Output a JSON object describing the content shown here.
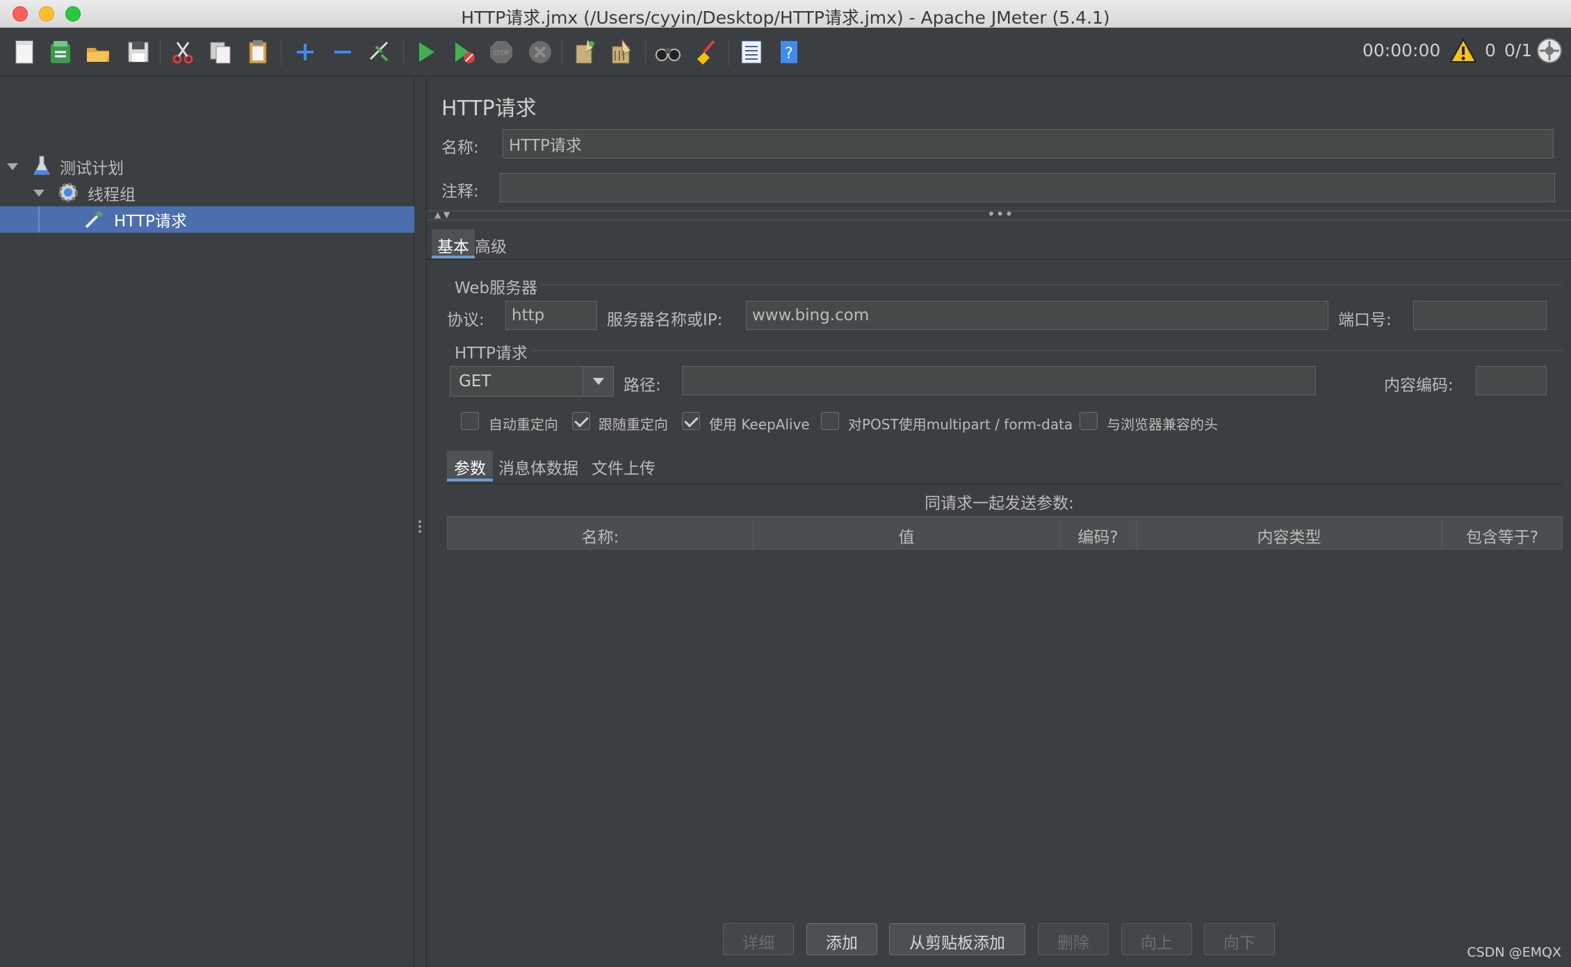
{
  "window": {
    "title": "HTTP请求.jmx (/Users/cyyin/Desktop/HTTP请求.jmx) - Apache JMeter (5.4.1)"
  },
  "toolbar": {
    "timer": "00:00:00",
    "warning_count": "0",
    "thread_ratio": "0/1",
    "icons": [
      "new-icon",
      "templates-icon",
      "open-icon",
      "save-icon",
      "cut-icon",
      "copy-icon",
      "paste-icon",
      "expand-icon",
      "collapse-icon",
      "toggle-icon",
      "start-icon",
      "start-no-pause-icon",
      "stop-icon",
      "shutdown-icon",
      "clear-icon",
      "clear-all-icon",
      "search-icon",
      "reset-search-icon",
      "function-helper-icon",
      "help-icon"
    ]
  },
  "tree": {
    "items": [
      {
        "label": "测试计划",
        "icon": "test-plan-icon"
      },
      {
        "label": "线程组",
        "icon": "gear-icon"
      },
      {
        "label": "HTTP请求",
        "icon": "pipette-icon"
      }
    ]
  },
  "main": {
    "title": "HTTP请求",
    "name_label": "名称:",
    "name_value": "HTTP请求",
    "comment_label": "注释:",
    "comment_value": "",
    "tabs": [
      {
        "label": "基本"
      },
      {
        "label": "高级"
      }
    ],
    "web_server": {
      "group_title": "Web服务器",
      "protocol_label": "协议:",
      "protocol_value": "http",
      "server_label": "服务器名称或IP:",
      "server_value": "www.bing.com",
      "port_label": "端口号:",
      "port_value": ""
    },
    "http_request": {
      "group_title": "HTTP请求",
      "method_value": "GET",
      "path_label": "路径:",
      "path_value": "",
      "encoding_label": "内容编码:",
      "encoding_value": ""
    },
    "checkboxes": [
      {
        "label": "自动重定向",
        "checked": false
      },
      {
        "label": "跟随重定向",
        "checked": true
      },
      {
        "label": "使用 KeepAlive",
        "checked": true
      },
      {
        "label": "对POST使用multipart / form-data",
        "checked": false
      },
      {
        "label": "与浏览器兼容的头",
        "checked": false
      }
    ],
    "subtabs": [
      {
        "label": "参数"
      },
      {
        "label": "消息体数据"
      },
      {
        "label": "文件上传"
      }
    ],
    "params_caption": "同请求一起发送参数:",
    "table_headers": [
      "名称:",
      "值",
      "编码?",
      "内容类型",
      "包含等于?"
    ],
    "buttons": [
      {
        "label": "详细",
        "enabled": false
      },
      {
        "label": "添加",
        "enabled": true
      },
      {
        "label": "从剪贴板添加",
        "enabled": true
      },
      {
        "label": "删除",
        "enabled": false
      },
      {
        "label": "向上",
        "enabled": false
      },
      {
        "label": "向下",
        "enabled": false
      }
    ]
  },
  "watermark": "CSDN @EMQX"
}
